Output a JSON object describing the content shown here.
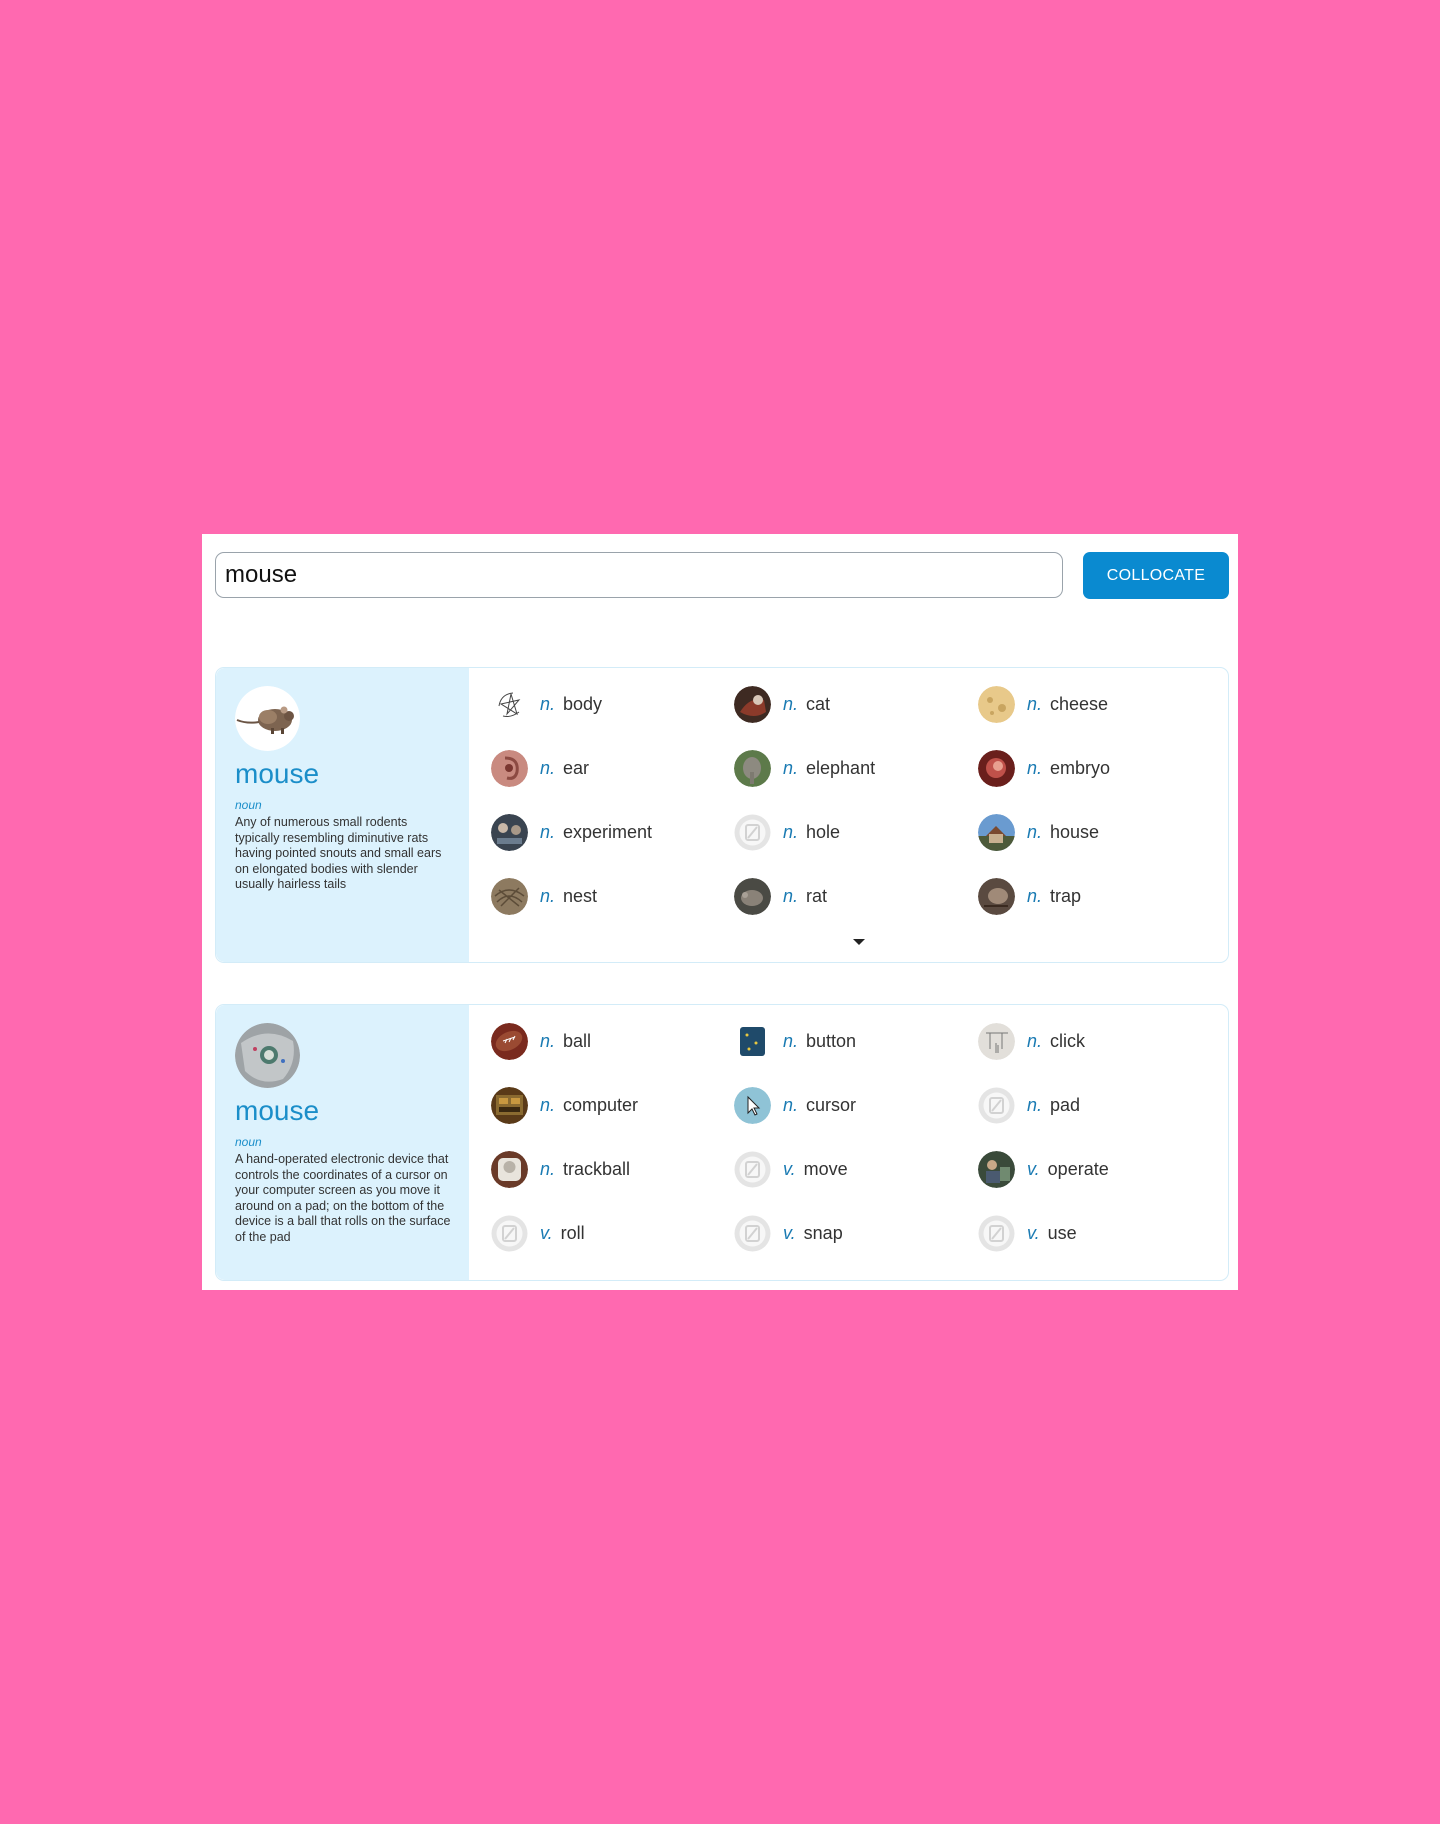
{
  "search": {
    "value": "mouse",
    "button_label": "COLLOCATE"
  },
  "senses": [
    {
      "word": "mouse",
      "pos": "noun",
      "definition": "Any of numerous small rodents typically resembling diminutive rats having pointed snouts and small ears on elongated bodies with slender usually hairless tails",
      "collocations": [
        {
          "pos": "n.",
          "word": "body",
          "icon": "drawing-thumbnail"
        },
        {
          "pos": "n.",
          "word": "cat",
          "icon": "cat-photo-thumbnail"
        },
        {
          "pos": "n.",
          "word": "cheese",
          "icon": "cheese-photo-thumbnail"
        },
        {
          "pos": "n.",
          "word": "ear",
          "icon": "ear-photo-thumbnail"
        },
        {
          "pos": "n.",
          "word": "elephant",
          "icon": "elephant-photo-thumbnail"
        },
        {
          "pos": "n.",
          "word": "embryo",
          "icon": "embryo-photo-thumbnail"
        },
        {
          "pos": "n.",
          "word": "experiment",
          "icon": "experiment-photo-thumbnail"
        },
        {
          "pos": "n.",
          "word": "hole",
          "icon": "no-image-placeholder"
        },
        {
          "pos": "n.",
          "word": "house",
          "icon": "house-photo-thumbnail"
        },
        {
          "pos": "n.",
          "word": "nest",
          "icon": "nest-photo-thumbnail"
        },
        {
          "pos": "n.",
          "word": "rat",
          "icon": "rat-photo-thumbnail"
        },
        {
          "pos": "n.",
          "word": "trap",
          "icon": "trap-photo-thumbnail"
        }
      ]
    },
    {
      "word": "mouse",
      "pos": "noun",
      "definition": "A hand-operated electronic device that controls the coordinates of a cursor on your computer screen as you move it around on a pad; on the bottom of the device is a ball that rolls on the surface of the pad",
      "collocations": [
        {
          "pos": "n.",
          "word": "ball",
          "icon": "ball-photo-thumbnail"
        },
        {
          "pos": "n.",
          "word": "button",
          "icon": "button-photo-thumbnail"
        },
        {
          "pos": "n.",
          "word": "click",
          "icon": "click-drawing-thumbnail"
        },
        {
          "pos": "n.",
          "word": "computer",
          "icon": "computer-photo-thumbnail"
        },
        {
          "pos": "n.",
          "word": "cursor",
          "icon": "cursor-thumbnail"
        },
        {
          "pos": "n.",
          "word": "pad",
          "icon": "no-image-placeholder"
        },
        {
          "pos": "n.",
          "word": "trackball",
          "icon": "trackball-photo-thumbnail"
        },
        {
          "pos": "v.",
          "word": "move",
          "icon": "no-image-placeholder"
        },
        {
          "pos": "v.",
          "word": "operate",
          "icon": "operate-photo-thumbnail"
        },
        {
          "pos": "v.",
          "word": "roll",
          "icon": "no-image-placeholder"
        },
        {
          "pos": "v.",
          "word": "snap",
          "icon": "no-image-placeholder"
        },
        {
          "pos": "v.",
          "word": "use",
          "icon": "no-image-placeholder"
        }
      ]
    }
  ],
  "colors": {
    "page_background": "#ff69b0",
    "accent": "#0a8ad0",
    "sense_panel": "#dcf2fd",
    "pos_text": "#1b7bb3"
  }
}
